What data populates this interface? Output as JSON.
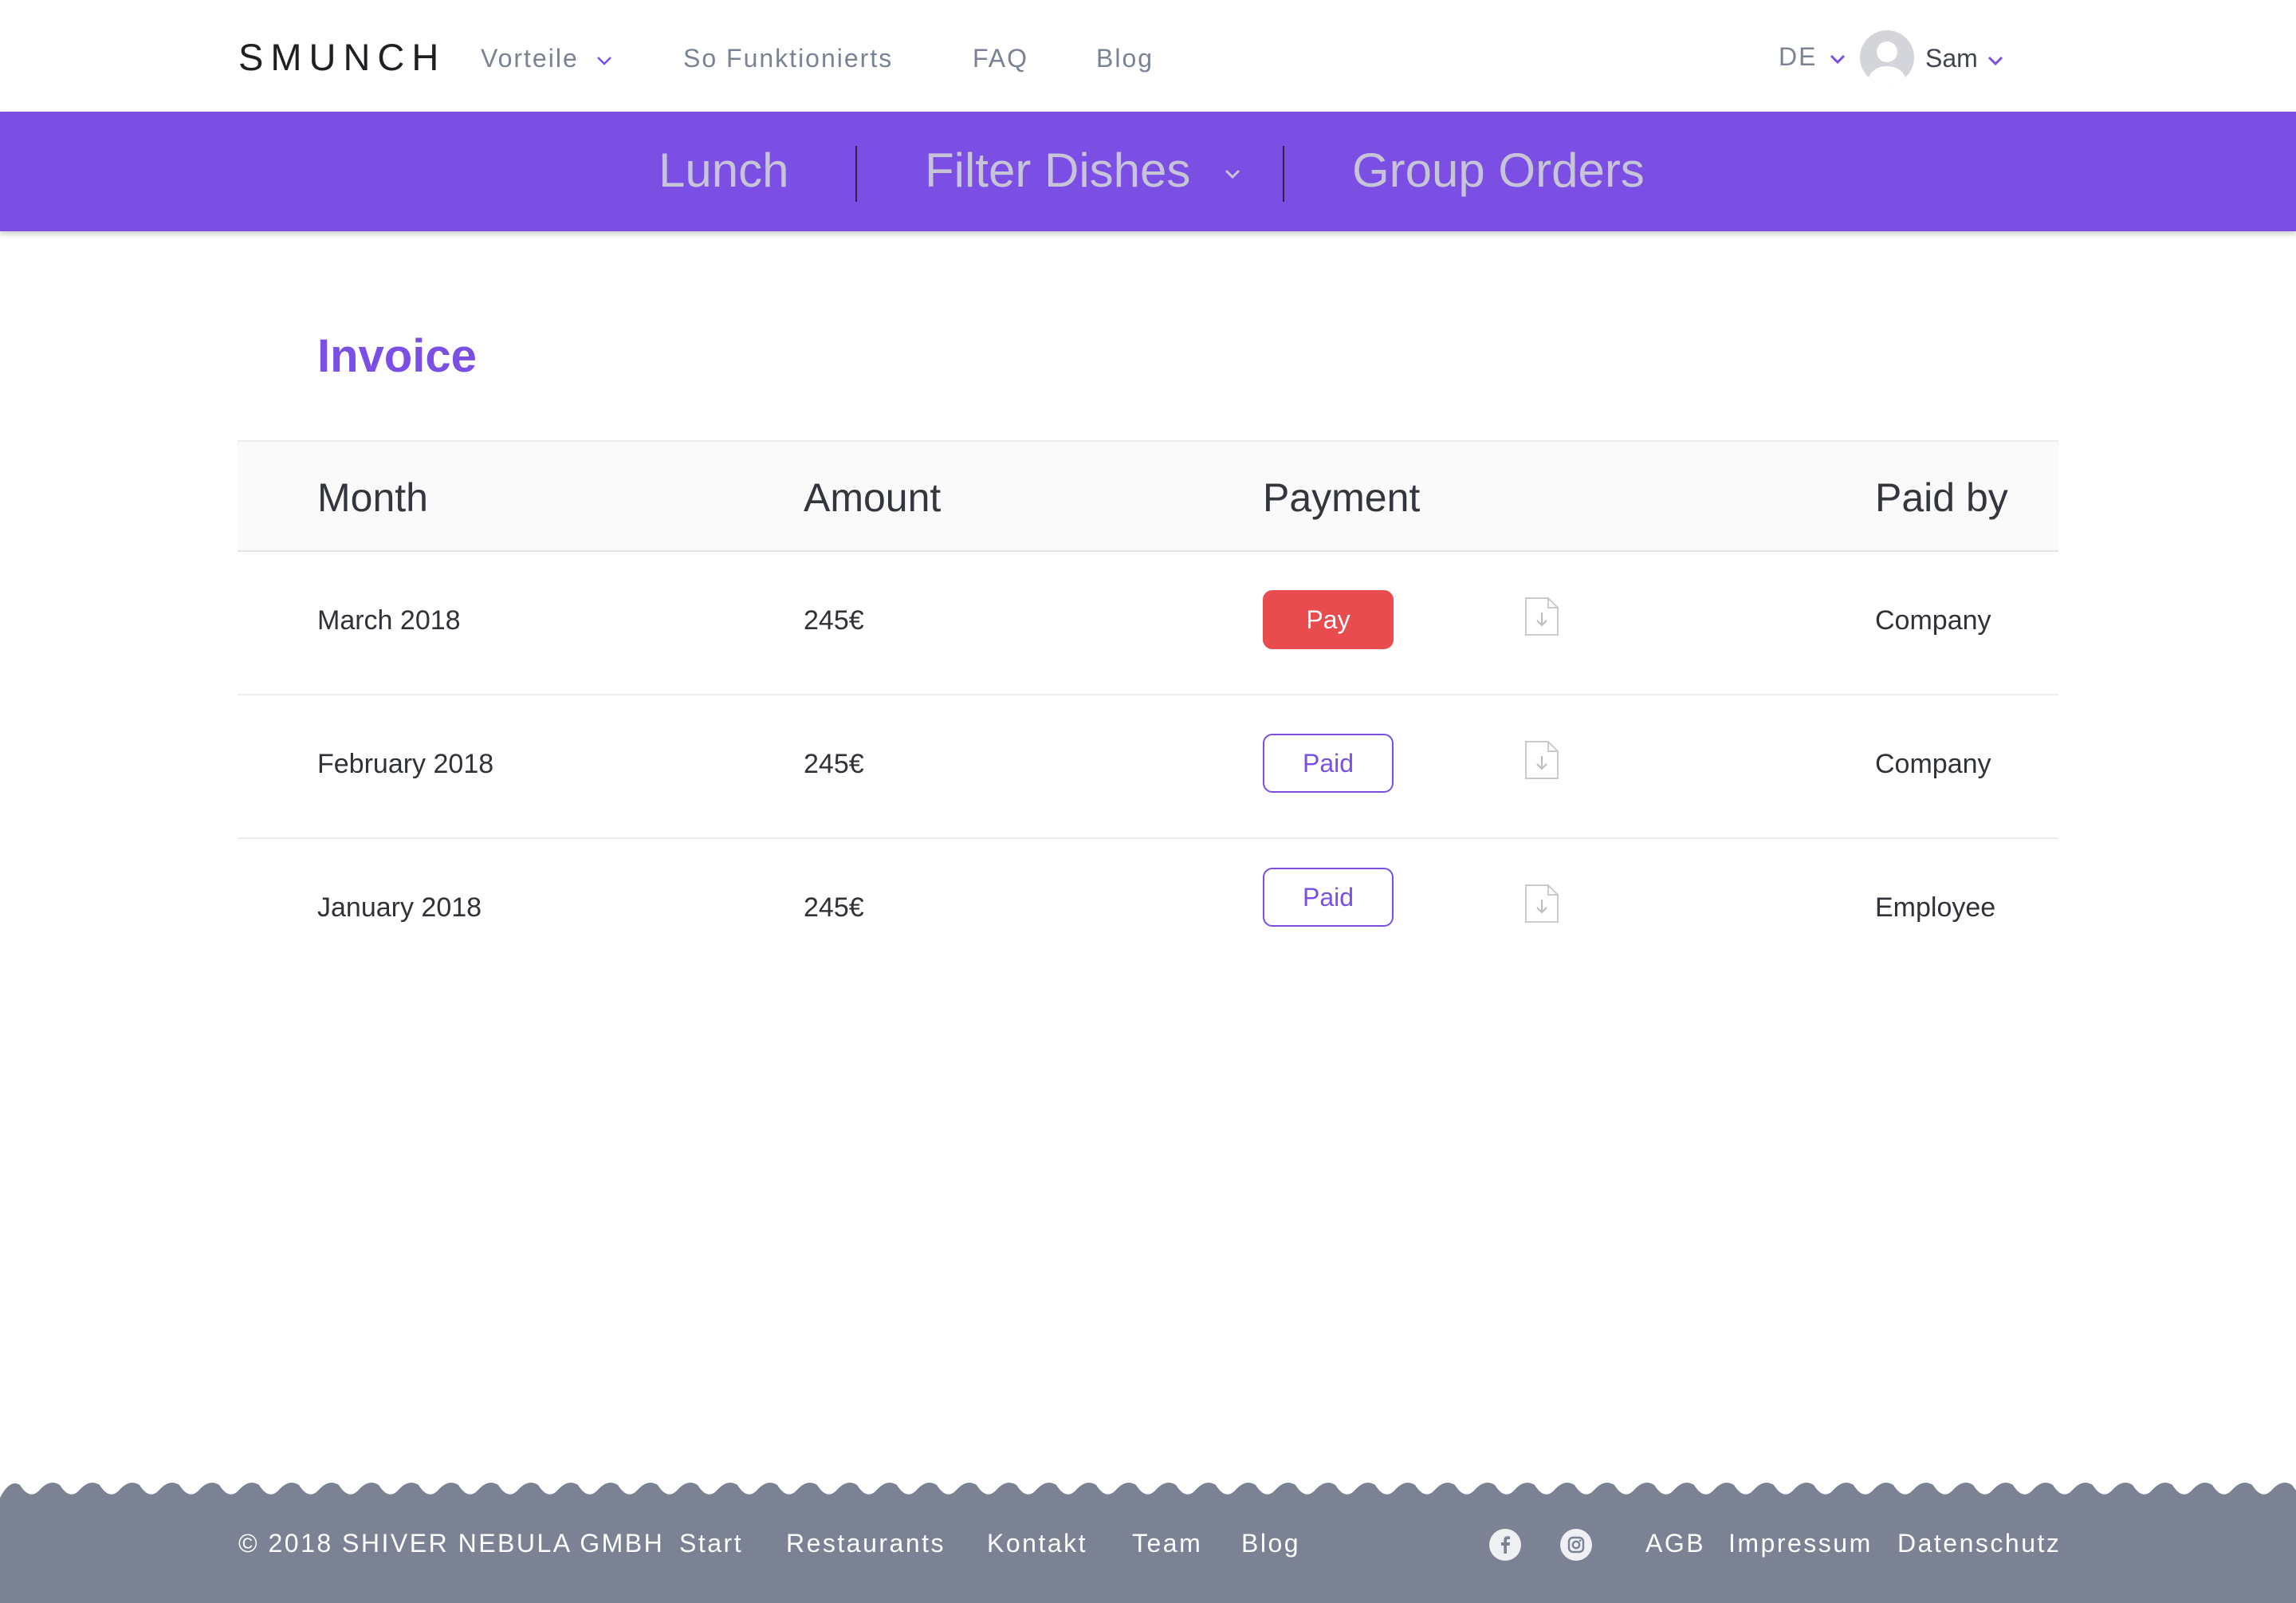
{
  "brand": {
    "logo": "SMUNCH",
    "accent_color": "#7b4fe3",
    "pay_color": "#e84c4f",
    "footer_color": "#7a8293"
  },
  "topnav": {
    "links": [
      "Vorteile",
      "So Funktionierts",
      "FAQ",
      "Blog"
    ],
    "language": "DE",
    "user_name": "Sam"
  },
  "subnav": {
    "items": [
      "Lunch",
      "Filter Dishes",
      "Group Orders"
    ]
  },
  "page": {
    "title": "Invoice"
  },
  "table": {
    "columns": [
      "Month",
      "Amount",
      "Payment",
      "Paid by"
    ],
    "rows": [
      {
        "month": "March 2018",
        "amount": "245€",
        "payment": "Pay",
        "paid_by": "Company"
      },
      {
        "month": "February 2018",
        "amount": "245€",
        "payment": "Paid",
        "paid_by": "Company"
      },
      {
        "month": "January 2018",
        "amount": "245€",
        "payment": "Paid",
        "paid_by": "Employee"
      }
    ]
  },
  "footer": {
    "copyright": "© 2018 SHIVER NEBULA GMBH",
    "links": [
      "Start",
      "Restaurants",
      "Kontakt",
      "Team",
      "Blog"
    ],
    "social_icons": [
      "facebook-icon",
      "instagram-icon"
    ],
    "legal_links": [
      "AGB",
      "Impressum",
      "Datenschutz"
    ]
  }
}
